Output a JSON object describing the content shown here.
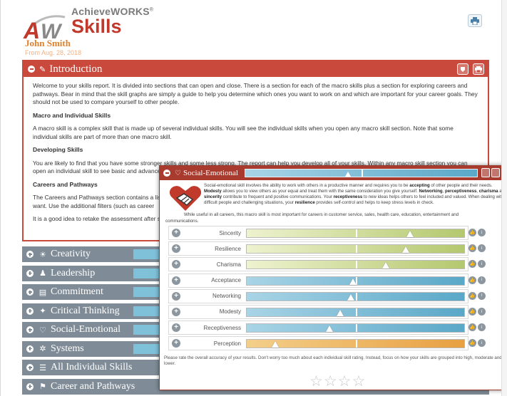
{
  "brand": {
    "top": "AchieveWORKS",
    "reg": "®",
    "skills": "Skills"
  },
  "user": {
    "name": "John Smith",
    "date": "From Aug. 28, 2018"
  },
  "intro": {
    "title": "Introduction",
    "p1": "Welcome to your skills report. It is divided into sections that can open and close. There is a section for each of the macro skills plus a section for exploring careers and pathways. Bear in mind that the skill graphs are simply a guide to help you determine which ones you want to work on and which are important for your career goals. They should not be used to compare yourself to other people.",
    "h1": "Macro and Individual Skills",
    "p2": "A macro skill is a complex skill that is made up of several individual skills. You will see the individual skills when you open any macro skill section. Note that some individual skills are part of more than one macro skill.",
    "h2": "Developing Skills",
    "p3": "You are likely to find that you have some stronger skills and some less strong. The report can help you develop all of your skills. Within any macro skill section you can open an individual skill to see basic and advanced",
    "h3": "Careers and Pathways",
    "p4": "The Careers and Pathways section contains a list of careers and pathways that might be a good fit for you. You can filter the list based on skills, or by the careers you want. Use the additional filters (such as career",
    "p5": "It is a good idea to retake the assessment after some time to see how your skills have developed as well."
  },
  "macro_skills": [
    {
      "label": "Creativity",
      "icon": "lightbulb-icon",
      "glyph": "☀"
    },
    {
      "label": "Leadership",
      "icon": "people-icon",
      "glyph": "♟"
    },
    {
      "label": "Commitment",
      "icon": "clipboard-icon",
      "glyph": "▤"
    },
    {
      "label": "Critical Thinking",
      "icon": "brain-icon",
      "glyph": "✦"
    },
    {
      "label": "Social-Emotional",
      "icon": "heart-icon",
      "glyph": "♡"
    },
    {
      "label": "Systems",
      "icon": "gear-icon",
      "glyph": "✲"
    },
    {
      "label": "All Individual Skills",
      "icon": "list-icon",
      "glyph": "☰"
    },
    {
      "label": "Career and Pathways",
      "icon": "people-walking-icon",
      "glyph": "⚑"
    }
  ],
  "modal": {
    "title": "Social-Emotional",
    "score": 0.43,
    "desc_parts": [
      {
        "t": "Social-emotional skill involves the ability to work with others in a productive manner and requires you to be "
      },
      {
        "t": "accepting",
        "b": true
      },
      {
        "t": " of other people and their needs. "
      },
      {
        "t": "Modesty",
        "b": true
      },
      {
        "t": " allows you to view others as your equal and treat them with the same consideration you give yourself. "
      },
      {
        "t": "Networking",
        "b": true
      },
      {
        "t": ", "
      },
      {
        "t": "perceptiveness",
        "b": true
      },
      {
        "t": ", "
      },
      {
        "t": "charisma",
        "b": true
      },
      {
        "t": " and "
      },
      {
        "t": "sincerity",
        "b": true
      },
      {
        "t": " contribute to frequent and positive communications. Your "
      },
      {
        "t": "receptiveness",
        "b": true
      },
      {
        "t": " to new ideas helps others to feel included and valued. When dealing with difficult people and challenging situations, your "
      },
      {
        "t": "resilience",
        "b": true
      },
      {
        "t": " provides self-control and helps to keep stress levels in check."
      }
    ],
    "note": "While useful in all careers, this macro skill is most important for careers in customer service, sales, health care, education, entertainment and",
    "note2": "communications.",
    "skills": [
      {
        "label": "Sincerity",
        "score": 0.75,
        "color": "green"
      },
      {
        "label": "Resilience",
        "score": 0.73,
        "color": "green"
      },
      {
        "label": "Charisma",
        "score": 0.64,
        "color": "green"
      },
      {
        "label": "Acceptance",
        "score": 0.49,
        "color": "blue"
      },
      {
        "label": "Networking",
        "score": 0.48,
        "color": "blue"
      },
      {
        "label": "Modesty",
        "score": 0.43,
        "color": "blue"
      },
      {
        "label": "Receptiveness",
        "score": 0.38,
        "color": "blue"
      },
      {
        "label": "Perception",
        "score": 0.13,
        "color": "orange"
      }
    ],
    "rate_text": "Please rate the overall accuracy of your results. Don't worry too much about each individual skill rating. Instead, focus on how your skills are grouped into high, moderate and lower.",
    "stars": [
      "☆",
      "☆",
      "☆",
      "☆"
    ]
  },
  "colors": {
    "accent": "#c94a3c",
    "macro_bar": "#7f8c97",
    "green": "#b4c86e",
    "blue": "#5aa8c8",
    "orange": "#e8a042"
  }
}
